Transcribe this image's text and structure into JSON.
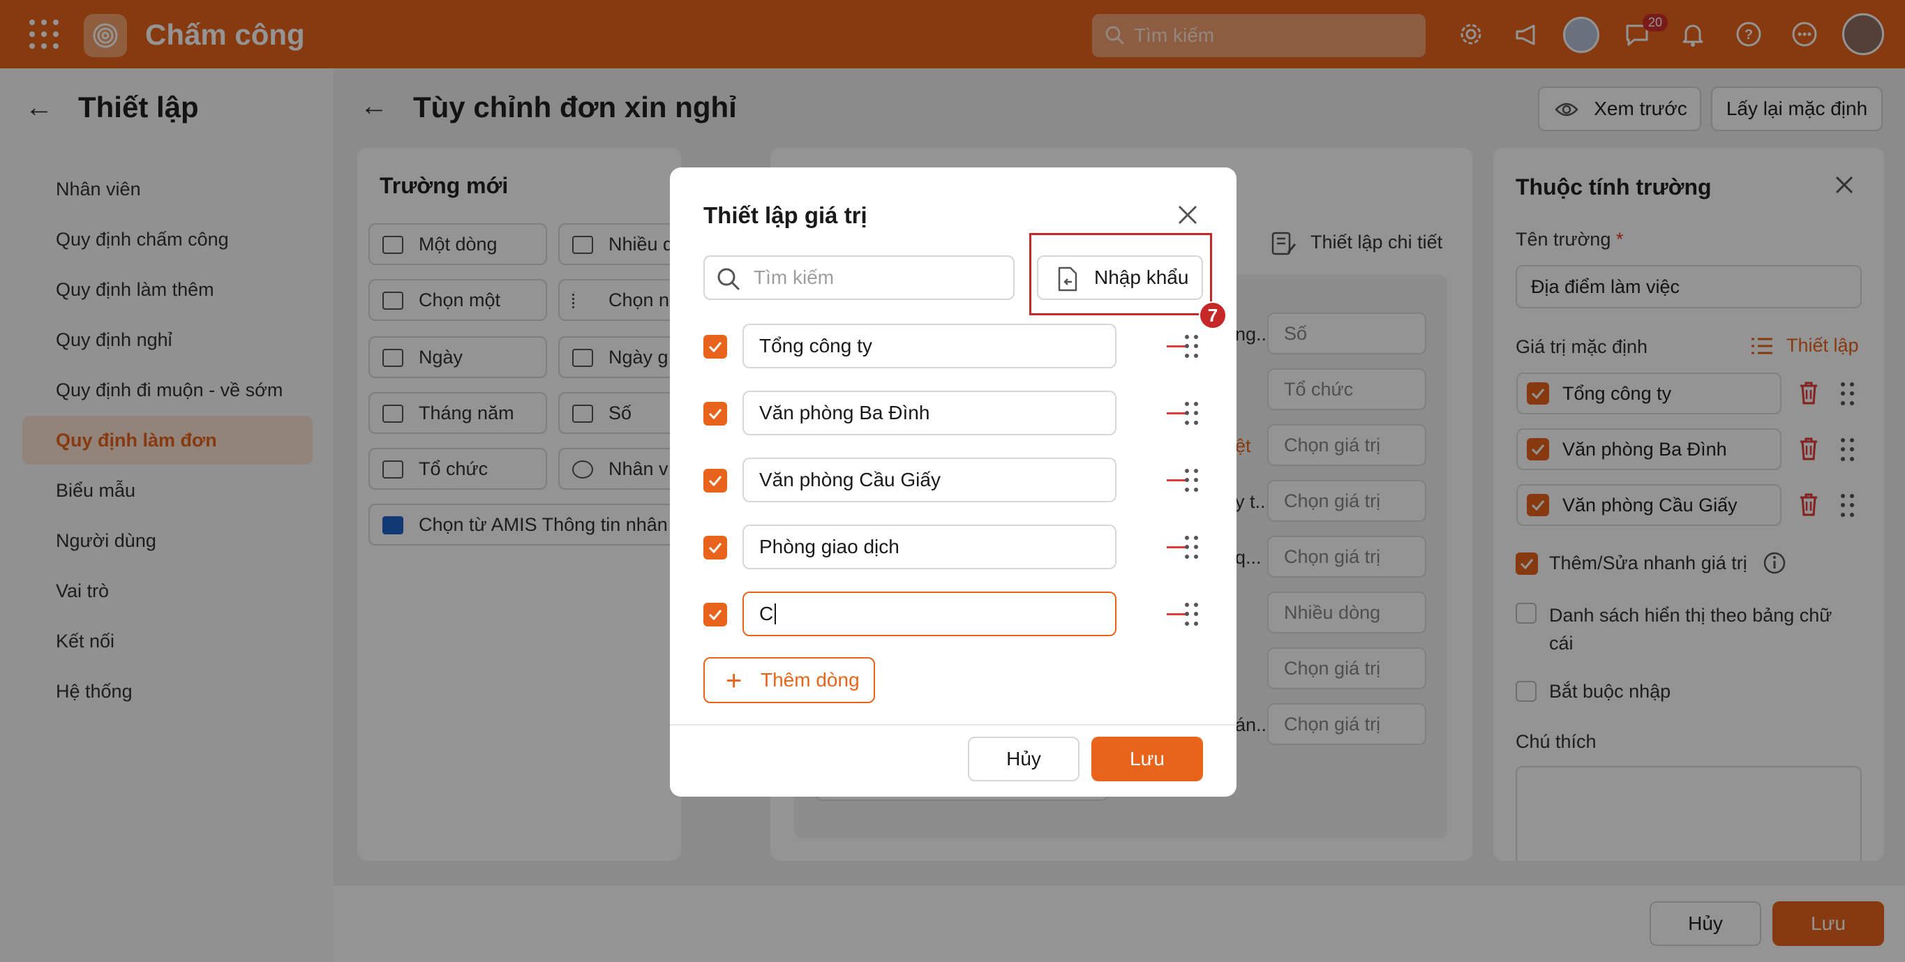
{
  "app": {
    "title": "Chấm công",
    "search_placeholder": "Tìm kiếm",
    "notification_count": "20"
  },
  "sidebar": {
    "title": "Thiết lập",
    "items": [
      {
        "label": "Nhân viên"
      },
      {
        "label": "Quy định chấm công"
      },
      {
        "label": "Quy định làm thêm"
      },
      {
        "label": "Quy định nghỉ"
      },
      {
        "label": "Quy định đi muộn - về sớm"
      },
      {
        "label": "Quy định làm đơn"
      },
      {
        "label": "Biểu mẫu"
      },
      {
        "label": "Người dùng"
      },
      {
        "label": "Vai trò"
      },
      {
        "label": "Kết nối"
      },
      {
        "label": "Hệ thống"
      }
    ],
    "active_item": "Quy định làm đơn"
  },
  "page": {
    "title": "Tùy chỉnh đơn xin nghỉ",
    "preview_label": "Xem trước",
    "reset_label": "Lấy lại mặc định"
  },
  "new_fields": {
    "title": "Trường mới",
    "items": [
      "Một dòng",
      "Nhiều d",
      "Chọn một",
      "Chọn n",
      "Ngày",
      "Ngày g",
      "Tháng năm",
      "Số",
      "Tổ chức",
      "Nhân v",
      "Chọn từ AMIS Thông tin nhân"
    ]
  },
  "middle": {
    "detail_label": "Thiết lập chi tiết",
    "rows": [
      {
        "left": "ng...",
        "value": "Số"
      },
      {
        "left": "",
        "value": "Tổ chức"
      },
      {
        "left": "ệt",
        "value": "Chọn giá trị"
      },
      {
        "left": "y t...",
        "value": "Chọn giá trị"
      },
      {
        "left": "q...",
        "value": "Chọn giá trị"
      },
      {
        "left": "",
        "value": "Nhiều dòng"
      },
      {
        "left": "",
        "value": "Chọn giá trị"
      },
      {
        "left": "án...",
        "value": "Chọn giá trị"
      }
    ]
  },
  "properties": {
    "title": "Thuộc tính trường",
    "field_name_label": "Tên trường",
    "required_mark": "*",
    "field_name_value": "Địa điểm làm việc",
    "default_label": "Giá trị mặc định",
    "setup_link": "Thiết lập",
    "default_values": [
      "Tổng công ty",
      "Văn phòng Ba Đình",
      "Văn phòng Cầu Giấy"
    ],
    "opt_quick_edit": "Thêm/Sửa nhanh giá trị",
    "opt_alphabet": "Danh sách hiển thị theo bảng chữ cái",
    "opt_required": "Bắt buộc nhập",
    "note_label": "Chú thích"
  },
  "footer": {
    "cancel_label": "Hủy",
    "save_label": "Lưu"
  },
  "modal": {
    "title": "Thiết lập giá trị",
    "search_placeholder": "Tìm kiếm",
    "import_label": "Nhập khẩu",
    "step_number": "7",
    "rows": [
      {
        "value": "Tổng công ty",
        "checked": true
      },
      {
        "value": "Văn phòng Ba Đình",
        "checked": true
      },
      {
        "value": "Văn phòng Cầu Giấy",
        "checked": true
      },
      {
        "value": "Phòng giao dịch",
        "checked": true
      },
      {
        "value": "C",
        "checked": true
      }
    ],
    "add_row_label": "Thêm dòng",
    "cancel_label": "Hủy",
    "save_label": "Lưu"
  },
  "colors": {
    "accent": "#e8641b",
    "highlight": "#c62828"
  }
}
